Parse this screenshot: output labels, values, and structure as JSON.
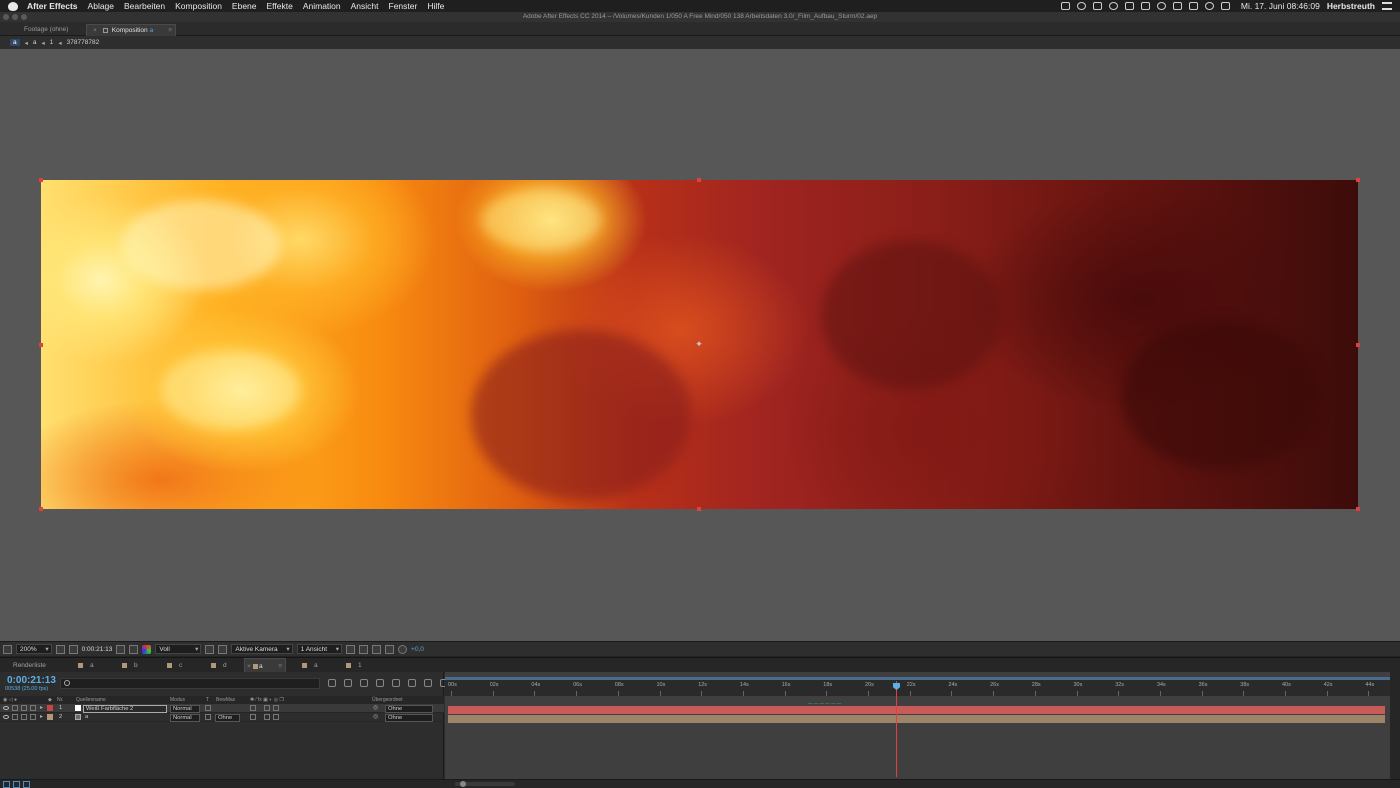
{
  "menubar": {
    "app": "After Effects",
    "items": [
      "Ablage",
      "Bearbeiten",
      "Komposition",
      "Ebene",
      "Effekte",
      "Animation",
      "Ansicht",
      "Fenster",
      "Hilfe"
    ],
    "clock": "Mi. 17. Juni  08:46:09",
    "user": "Herbstreuth"
  },
  "window": {
    "title": "Adobe After Effects CC 2014 – /Volumes/Kunden 1/050 A Free Mind/050 138 Arbeitsdaten 3.0/_Film_Aufbau_Sturm/02.aep"
  },
  "viewer": {
    "tabs": {
      "footage": "Footage (ohne)",
      "composition": "Komposition",
      "comp_current": "a"
    },
    "breadcrumb": {
      "items": [
        "a",
        "a",
        "1"
      ],
      "id": "378778782"
    }
  },
  "viewer_toolbar": {
    "zoom": "200%",
    "timecode": "0:00:21:13",
    "resolution": "Voll",
    "camera": "Aktive Kamera",
    "views": "1 Ansicht",
    "exposure": "+0,0"
  },
  "timeline_tabs": {
    "render": "Renderliste",
    "tabs": [
      "a",
      "b",
      "c",
      "d",
      "a",
      "a",
      "1"
    ],
    "active_index": 4
  },
  "timeline": {
    "timecode": "0:00:21:13",
    "fps": "00538 (25.00 fps)",
    "columns": {
      "nr": "Nr.",
      "source": "Quellenname",
      "mode": "Modus",
      "t": "T",
      "trkmat": "BewMas",
      "parent": "Übergeordnet"
    },
    "layers": [
      {
        "nr": "1",
        "name": "Weiß Farbfläche 2",
        "mode": "Normal",
        "trkmat": "",
        "parent": "Ohne",
        "label_color": "#c84444"
      },
      {
        "nr": "2",
        "name": "a",
        "mode": "Normal",
        "trkmat": "Ohne",
        "parent": "Ohne",
        "label_color": "#b09878"
      }
    ],
    "ruler": [
      "00s",
      "02s",
      "04s",
      "06s",
      "08s",
      "10s",
      "12s",
      "14s",
      "16s",
      "18s",
      "20s",
      "22s",
      "24s",
      "26s",
      "28s",
      "30s",
      "32s",
      "34s",
      "36s",
      "38s",
      "40s",
      "42s",
      "44s"
    ],
    "bar_colors": {
      "layer1": "#c85a5a",
      "layer2": "#9d8468"
    }
  }
}
